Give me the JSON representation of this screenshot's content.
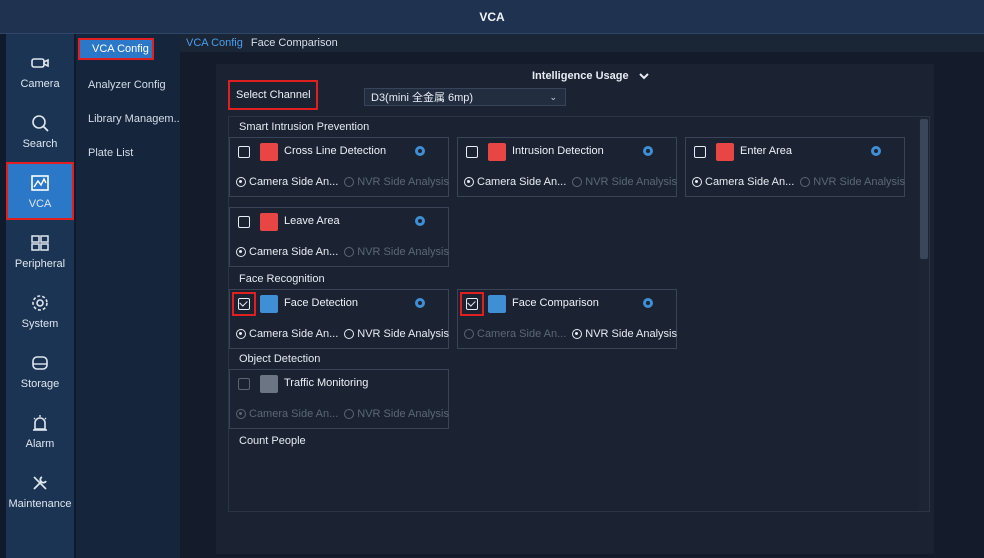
{
  "window": {
    "title": "VCA"
  },
  "leftnav": [
    {
      "label": "Camera",
      "icon": "camera-icon"
    },
    {
      "label": "Search",
      "icon": "search-icon"
    },
    {
      "label": "VCA",
      "icon": "vca-icon",
      "active": true
    },
    {
      "label": "Peripheral",
      "icon": "peripheral-icon"
    },
    {
      "label": "System",
      "icon": "gear-icon"
    },
    {
      "label": "Storage",
      "icon": "storage-icon"
    },
    {
      "label": "Alarm",
      "icon": "alarm-icon"
    },
    {
      "label": "Maintenance",
      "icon": "wrench-icon"
    }
  ],
  "subnav": [
    {
      "label": "VCA Config",
      "active": true
    },
    {
      "label": "Analyzer Config"
    },
    {
      "label": "Library Managem..."
    },
    {
      "label": "Plate List"
    }
  ],
  "breadcrumb": {
    "item1": "VCA Config",
    "item2": "Face Comparison"
  },
  "intelligence_usage": "Intelligence Usage",
  "select_channel": {
    "label": "Select Channel",
    "value": "D3(mini 全金属 6mp)"
  },
  "sections": {
    "smart_intrusion": "Smart Intrusion Prevention",
    "face_recognition": "Face Recognition",
    "object_detection": "Object Detection",
    "count_people": "Count People"
  },
  "radio_labels": {
    "camera": "Camera Side An...",
    "nvr": "NVR Side Analysis"
  },
  "functions": {
    "cross_line": {
      "name": "Cross Line Detection",
      "checked": false
    },
    "intrusion": {
      "name": "Intrusion Detection",
      "checked": false
    },
    "enter_area": {
      "name": "Enter Area",
      "checked": false
    },
    "leave_area": {
      "name": "Leave Area",
      "checked": false
    },
    "face_detection": {
      "name": "Face Detection",
      "checked": true
    },
    "face_comparison": {
      "name": "Face Comparison",
      "checked": true
    },
    "traffic": {
      "name": "Traffic Monitoring",
      "checked": false
    }
  },
  "colors": {
    "accent": "#2b78c9",
    "highlight": "#e02020",
    "icon_red": "#e84545",
    "icon_blue": "#3f8fd6"
  }
}
